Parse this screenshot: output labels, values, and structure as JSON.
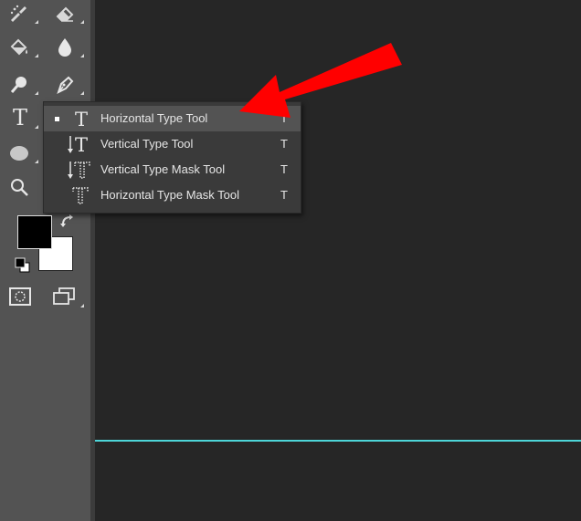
{
  "toolbar": {
    "tools": [
      {
        "name": "spot-healing-brush-icon"
      },
      {
        "name": "eraser-icon"
      },
      {
        "name": "paint-bucket-icon"
      },
      {
        "name": "blur-drop-icon"
      },
      {
        "name": "dodge-icon"
      },
      {
        "name": "pen-icon"
      },
      {
        "name": "type-icon",
        "glyph": "T"
      },
      {
        "name": "ellipse-icon"
      },
      {
        "name": "zoom-icon"
      },
      {
        "name": "quick-mask-icon"
      },
      {
        "name": "screen-mode-icon"
      }
    ],
    "foreground_color": "#000000",
    "background_color": "#ffffff"
  },
  "flyout": {
    "items": [
      {
        "label": "Horizontal Type Tool",
        "shortcut": "T",
        "selected": true,
        "icon": "horizontal-type-icon"
      },
      {
        "label": "Vertical Type Tool",
        "shortcut": "T",
        "selected": false,
        "icon": "vertical-type-icon"
      },
      {
        "label": "Vertical Type Mask Tool",
        "shortcut": "T",
        "selected": false,
        "icon": "vertical-type-mask-icon"
      },
      {
        "label": "Horizontal Type Mask Tool",
        "shortcut": "T",
        "selected": false,
        "icon": "horizontal-type-mask-icon"
      }
    ]
  },
  "colors": {
    "panel": "#535353",
    "canvas": "#262626",
    "guide": "#4dd5d8",
    "annotation_arrow": "#ff0000"
  }
}
